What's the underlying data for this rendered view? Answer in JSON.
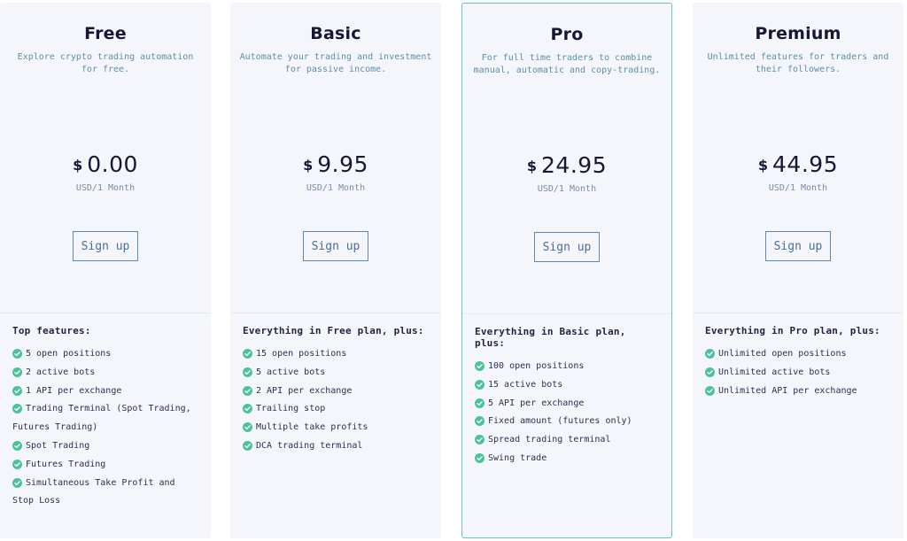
{
  "accent_color": "#5fc9b2",
  "check_color": "#4cc29c",
  "plans": [
    {
      "name": "Free",
      "description": "Explore crypto trading automation for free.",
      "currency": "$",
      "price": "0.00",
      "period": "USD/1 Month",
      "signup_label": "Sign up",
      "features_title": "Top features:",
      "features": [
        "5 open positions",
        "2 active bots",
        "1 API per exchange",
        "Trading Terminal (Spot Trading, Futures Trading)",
        "Spot Trading",
        "Futures Trading",
        "Simultaneous Take Profit and Stop Loss"
      ]
    },
    {
      "name": "Basic",
      "description": "Automate your trading and investment for passive income.",
      "currency": "$",
      "price": "9.95",
      "period": "USD/1 Month",
      "signup_label": "Sign up",
      "features_title": "Everything in Free plan, plus:",
      "features": [
        "15 open positions",
        "5 active bots",
        "2 API per exchange",
        "Trailing stop",
        "Multiple take profits",
        "DCA trading terminal"
      ]
    },
    {
      "name": "Pro",
      "description": "For full time traders to combine manual, automatic and copy-trading.",
      "currency": "$",
      "price": "24.95",
      "period": "USD/1 Month",
      "signup_label": "Sign up",
      "features_title": "Everything in Basic plan, plus:",
      "highlighted": true,
      "features": [
        "100 open positions",
        "15 active bots",
        "5 API per exchange",
        "Fixed amount (futures only)",
        "Spread trading terminal",
        "Swing trade"
      ]
    },
    {
      "name": "Premium",
      "description": "Unlimited features for traders and their followers.",
      "currency": "$",
      "price": "44.95",
      "period": "USD/1 Month",
      "signup_label": "Sign up",
      "features_title": "Everything in Pro plan, plus:",
      "features": [
        "Unlimited open positions",
        "Unlimited active bots",
        "Unlimited API per exchange"
      ]
    }
  ]
}
